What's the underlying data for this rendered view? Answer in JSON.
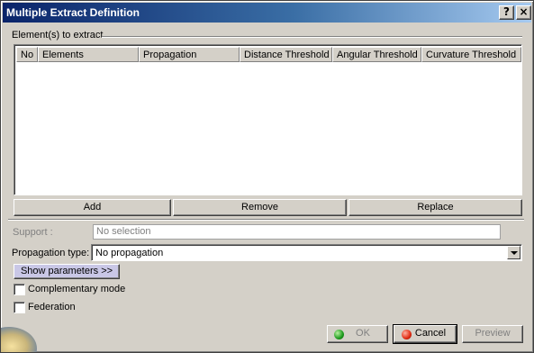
{
  "window": {
    "title": "Multiple Extract Definition",
    "help_glyph": "?",
    "close_glyph": "×"
  },
  "elements_group": {
    "title": "Element(s) to extract",
    "columns": [
      "No",
      "Elements",
      "Propagation",
      "Distance Threshold",
      "Angular Threshold",
      "Curvature Threshold"
    ],
    "rows": []
  },
  "actions": {
    "add": "Add",
    "remove": "Remove",
    "replace": "Replace"
  },
  "support": {
    "label": "Support :",
    "value": "No selection",
    "enabled": false
  },
  "propagation": {
    "label": "Propagation type:",
    "selected": "No propagation"
  },
  "show_parameters": "Show parameters >>",
  "checkboxes": {
    "complementary": {
      "label": "Complementary mode",
      "checked": false
    },
    "federation": {
      "label": "Federation",
      "checked": false
    }
  },
  "dialog_buttons": {
    "ok": "OK",
    "cancel": "Cancel",
    "preview": "Preview",
    "ok_enabled": false,
    "preview_enabled": false
  },
  "colors": {
    "dialog_bg": "#d4d0c8",
    "title_start": "#0a246a",
    "title_end": "#a6caf0",
    "show_params_bg": "#c9c7e6"
  },
  "icons": [
    "help-icon",
    "close-icon",
    "dropdown-arrow-icon",
    "ok-status-icon",
    "cancel-status-icon"
  ]
}
